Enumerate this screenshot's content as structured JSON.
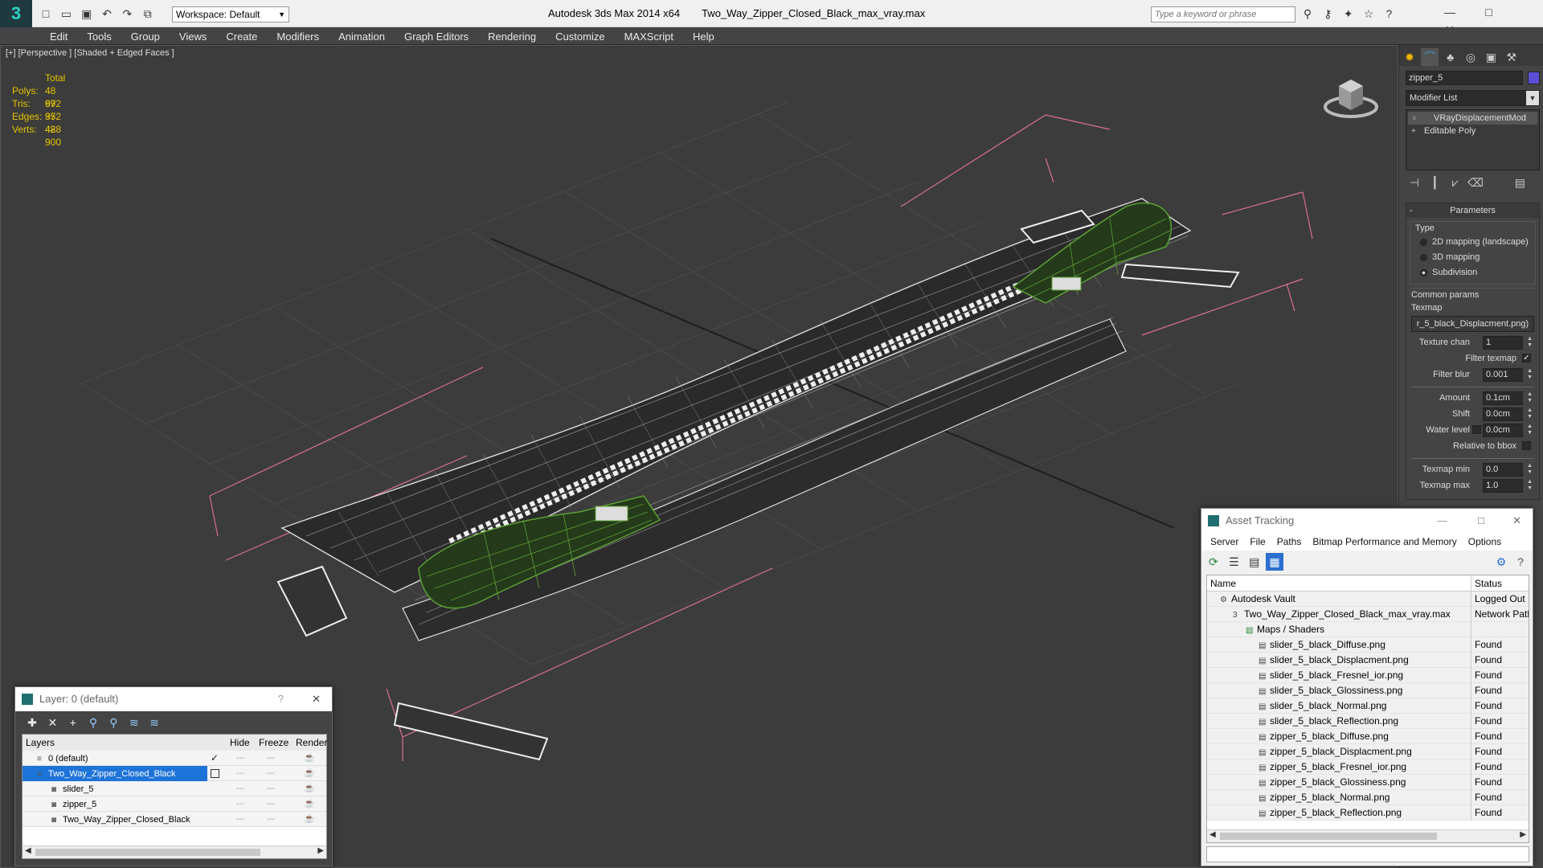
{
  "app": {
    "title": "Autodesk 3ds Max  2014 x64",
    "file": "Two_Way_Zipper_Closed_Black_max_vray.max",
    "workspace": "Workspace: Default",
    "search_placeholder": "Type a keyword or phrase"
  },
  "menu": [
    "Edit",
    "Tools",
    "Group",
    "Views",
    "Create",
    "Modifiers",
    "Animation",
    "Graph Editors",
    "Rendering",
    "Customize",
    "MAXScript",
    "Help"
  ],
  "viewport": {
    "label": "[+] [Perspective ] [Shaded + Edged Faces ]",
    "stats": {
      "total_label": "Total",
      "rows": [
        {
          "k": "Polys:",
          "v": "48 692"
        },
        {
          "k": "Tris:",
          "v": "97 352"
        },
        {
          "k": "Edges:",
          "v": "97 428"
        },
        {
          "k": "Verts:",
          "v": "48 900"
        }
      ]
    }
  },
  "command_panel": {
    "object_name": "zipper_5",
    "modifier_list": "Modifier List",
    "stack": [
      "VRayDisplacementMod",
      "Editable Poly"
    ],
    "parameters_title": "Parameters",
    "type_label": "Type",
    "type_options": [
      "2D mapping (landscape)",
      "3D mapping",
      "Subdivision"
    ],
    "common_params": "Common params",
    "texmap_label": "Texmap",
    "texmap_value": "r_5_black_Displacment.png)",
    "texture_chan_label": "Texture chan",
    "texture_chan": "1",
    "filter_texmap": "Filter texmap",
    "filter_blur_label": "Filter blur",
    "filter_blur": "0.001",
    "amount_label": "Amount",
    "amount": "0.1cm",
    "shift_label": "Shift",
    "shift": "0.0cm",
    "water_level_label": "Water level",
    "water_level": "0.0cm",
    "relative_bbox": "Relative to bbox",
    "texmap_min_label": "Texmap min",
    "texmap_min": "0.0",
    "texmap_max_label": "Texmap max",
    "texmap_max": "1.0"
  },
  "layer_window": {
    "title": "Layer: 0 (default)",
    "help": "?",
    "columns": [
      "Layers",
      "Hide",
      "Freeze",
      "Render"
    ],
    "rows": [
      {
        "name": "0 (default)",
        "indent": 1,
        "selected": false
      },
      {
        "name": "Two_Way_Zipper_Closed_Black",
        "indent": 1,
        "selected": true
      },
      {
        "name": "slider_5",
        "indent": 2,
        "selected": false
      },
      {
        "name": "zipper_5",
        "indent": 2,
        "selected": false
      },
      {
        "name": "Two_Way_Zipper_Closed_Black",
        "indent": 2,
        "selected": false
      }
    ]
  },
  "asset_window": {
    "title": "Asset Tracking",
    "menu": [
      "Server",
      "File",
      "Paths",
      "Bitmap Performance and Memory",
      "Options"
    ],
    "columns": [
      "Name",
      "Status"
    ],
    "rows": [
      {
        "name": "Autodesk Vault",
        "status": "Logged Out ...",
        "indent": 1
      },
      {
        "name": "Two_Way_Zipper_Closed_Black_max_vray.max",
        "status": "Network Path",
        "indent": 2
      },
      {
        "name": "Maps / Shaders",
        "status": "",
        "indent": 3
      },
      {
        "name": "slider_5_black_Diffuse.png",
        "status": "Found",
        "indent": 4
      },
      {
        "name": "slider_5_black_Displacment.png",
        "status": "Found",
        "indent": 4
      },
      {
        "name": "slider_5_black_Fresnel_ior.png",
        "status": "Found",
        "indent": 4
      },
      {
        "name": "slider_5_black_Glossiness.png",
        "status": "Found",
        "indent": 4
      },
      {
        "name": "slider_5_black_Normal.png",
        "status": "Found",
        "indent": 4
      },
      {
        "name": "slider_5_black_Reflection.png",
        "status": "Found",
        "indent": 4
      },
      {
        "name": "zipper_5_black_Diffuse.png",
        "status": "Found",
        "indent": 4
      },
      {
        "name": "zipper_5_black_Displacment.png",
        "status": "Found",
        "indent": 4
      },
      {
        "name": "zipper_5_black_Fresnel_ior.png",
        "status": "Found",
        "indent": 4
      },
      {
        "name": "zipper_5_black_Glossiness.png",
        "status": "Found",
        "indent": 4
      },
      {
        "name": "zipper_5_black_Normal.png",
        "status": "Found",
        "indent": 4
      },
      {
        "name": "zipper_5_black_Reflection.png",
        "status": "Found",
        "indent": 4
      }
    ]
  },
  "colors": {
    "accent": "#1e73d8",
    "stats": "#e5c400",
    "wire_green": "#5ca035",
    "bbox": "#d9708a"
  }
}
